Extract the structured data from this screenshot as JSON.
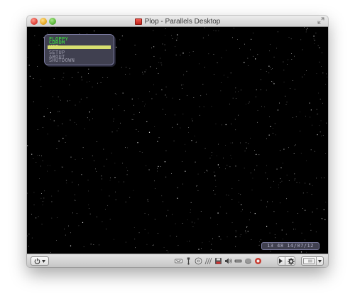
{
  "window": {
    "title": "Plop - Parallels Desktop"
  },
  "vm_screen": {
    "boot_menu": {
      "items": [
        {
          "label": "FLOPPY",
          "state": "normal",
          "color": "#3cf03c"
        },
        {
          "label": "CDROM",
          "state": "normal",
          "color": "#3cf03c"
        },
        {
          "label": "USB",
          "state": "selected",
          "color": "#d8e070"
        },
        {
          "label": "SETUP",
          "state": "normal",
          "color": "#9a9aaa"
        },
        {
          "label": "ABOUT",
          "state": "normal",
          "color": "#9a9aaa"
        },
        {
          "label": "SHUTDOWN",
          "state": "normal",
          "color": "#9a9aaa"
        }
      ]
    },
    "clock": {
      "text": "13 48 14/07/12"
    },
    "background": "#000000",
    "star_color": "#ffffff"
  },
  "statusbar": {
    "power_icon": "power-icon",
    "device_icons": [
      "keyboard-icon",
      "usb-icon",
      "cd-icon",
      "floppy-icon",
      "save-icon",
      "sound-icon",
      "network-icon",
      "disk-icon",
      "stop-icon"
    ],
    "settings_icon": "gear-icon",
    "view_icon": "window-mode-icon"
  },
  "colors": {
    "menu_bg": "#404050",
    "menu_border": "#7a7aa0",
    "green_text": "#3cf03c",
    "selected_bar": "#d8e070",
    "grey_text": "#9a9aaa"
  }
}
